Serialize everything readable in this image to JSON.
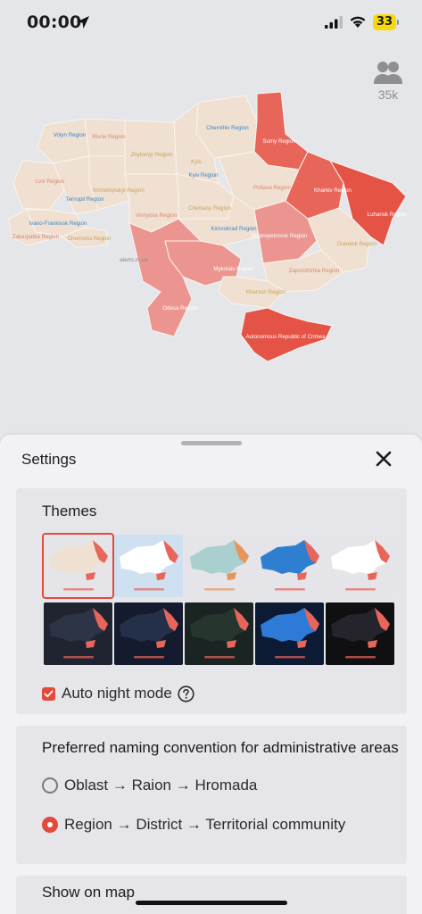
{
  "status_bar": {
    "time": "00:00",
    "battery": "33",
    "icons": [
      "location-arrow-icon",
      "cellular-signal-icon",
      "wifi-icon",
      "battery-icon"
    ]
  },
  "users": {
    "icon": "users-icon",
    "count": "35k"
  },
  "map": {
    "watermark": "alerts.in.ua",
    "colors": {
      "calm": "#f0e0d2",
      "alert": "#e8655a",
      "alert_light": "#ec9590",
      "alert_strong": "#e45346"
    },
    "regions": [
      {
        "name": "Volyn Region",
        "status": "calm"
      },
      {
        "name": "Rivne Region",
        "status": "calm"
      },
      {
        "name": "Zhytomyr Region",
        "status": "calm"
      },
      {
        "name": "Chernihiv Region",
        "status": "calm"
      },
      {
        "name": "Sumy Region",
        "status": "alert"
      },
      {
        "name": "Kyiv",
        "status": "calm"
      },
      {
        "name": "Kyiv Region",
        "status": "calm"
      },
      {
        "name": "Lviv Region",
        "status": "calm"
      },
      {
        "name": "Khmelnytskyi Region",
        "status": "calm"
      },
      {
        "name": "Ternopil Region",
        "status": "calm"
      },
      {
        "name": "Poltava Region",
        "status": "calm"
      },
      {
        "name": "Kharkiv Region",
        "status": "alert"
      },
      {
        "name": "Luhansk Region",
        "status": "alert_strong"
      },
      {
        "name": "Vinnytsia Region",
        "status": "calm"
      },
      {
        "name": "Cherkasy Region",
        "status": "calm"
      },
      {
        "name": "Ivano-Frankivsk Region",
        "status": "calm"
      },
      {
        "name": "Zakarpattia Region",
        "status": "calm"
      },
      {
        "name": "Chernivtsi Region",
        "status": "calm"
      },
      {
        "name": "Kirovohrad Region",
        "status": "calm"
      },
      {
        "name": "Dnipropetrovsk Region",
        "status": "alert_light"
      },
      {
        "name": "Donetsk Region",
        "status": "calm"
      },
      {
        "name": "Mykolaiv Region",
        "status": "alert_light"
      },
      {
        "name": "Zaporizhzhia Region",
        "status": "calm"
      },
      {
        "name": "Kherson Region",
        "status": "calm"
      },
      {
        "name": "Odesa Region",
        "status": "alert_light"
      },
      {
        "name": "Autonomous Republic of Crimea",
        "status": "alert_strong"
      }
    ]
  },
  "settings": {
    "title": "Settings",
    "close_icon": "close-icon",
    "themes": {
      "title": "Themes",
      "selected_index": 0,
      "items": [
        {
          "name": "light",
          "bg": "#e5e5e9",
          "land": "#f0e0d2",
          "alert": "#e8655a"
        },
        {
          "name": "light-blue",
          "bg": "#cfe0f0",
          "land": "#ffffff",
          "alert": "#e8655a"
        },
        {
          "name": "teal",
          "bg": "#e5e5e9",
          "land": "#a9cfcf",
          "alert": "#e8955a"
        },
        {
          "name": "blue",
          "bg": "#e5e5e9",
          "land": "#2f7fd0",
          "alert": "#e8655a"
        },
        {
          "name": "white",
          "bg": "#e5e5e9",
          "land": "#ffffff",
          "alert": "#e8655a"
        },
        {
          "name": "dark",
          "bg": "#1f2430",
          "land": "#2c3445",
          "alert": "#e8655a"
        },
        {
          "name": "dark-navy",
          "bg": "#141b2e",
          "land": "#24304a",
          "alert": "#e8655a"
        },
        {
          "name": "dark-green",
          "bg": "#1a2422",
          "land": "#27352f",
          "alert": "#e8655a"
        },
        {
          "name": "dark-blue",
          "bg": "#0c1a33",
          "land": "#2d7bd6",
          "alert": "#e8655a"
        },
        {
          "name": "black",
          "bg": "#101012",
          "land": "#24242a",
          "alert": "#e8655a"
        }
      ],
      "auto_night_mode": {
        "label": "Auto night mode",
        "checked": true,
        "help_icon": "help-icon"
      }
    },
    "naming": {
      "title": "Preferred naming convention for administrative areas",
      "options": [
        {
          "label": "Oblast → Raion → Hromada",
          "checked": false
        },
        {
          "label": "Region → District → Territorial community",
          "checked": true
        }
      ]
    },
    "show_on_map": {
      "title": "Show on map"
    }
  },
  "accent_color": "#e24a3b"
}
